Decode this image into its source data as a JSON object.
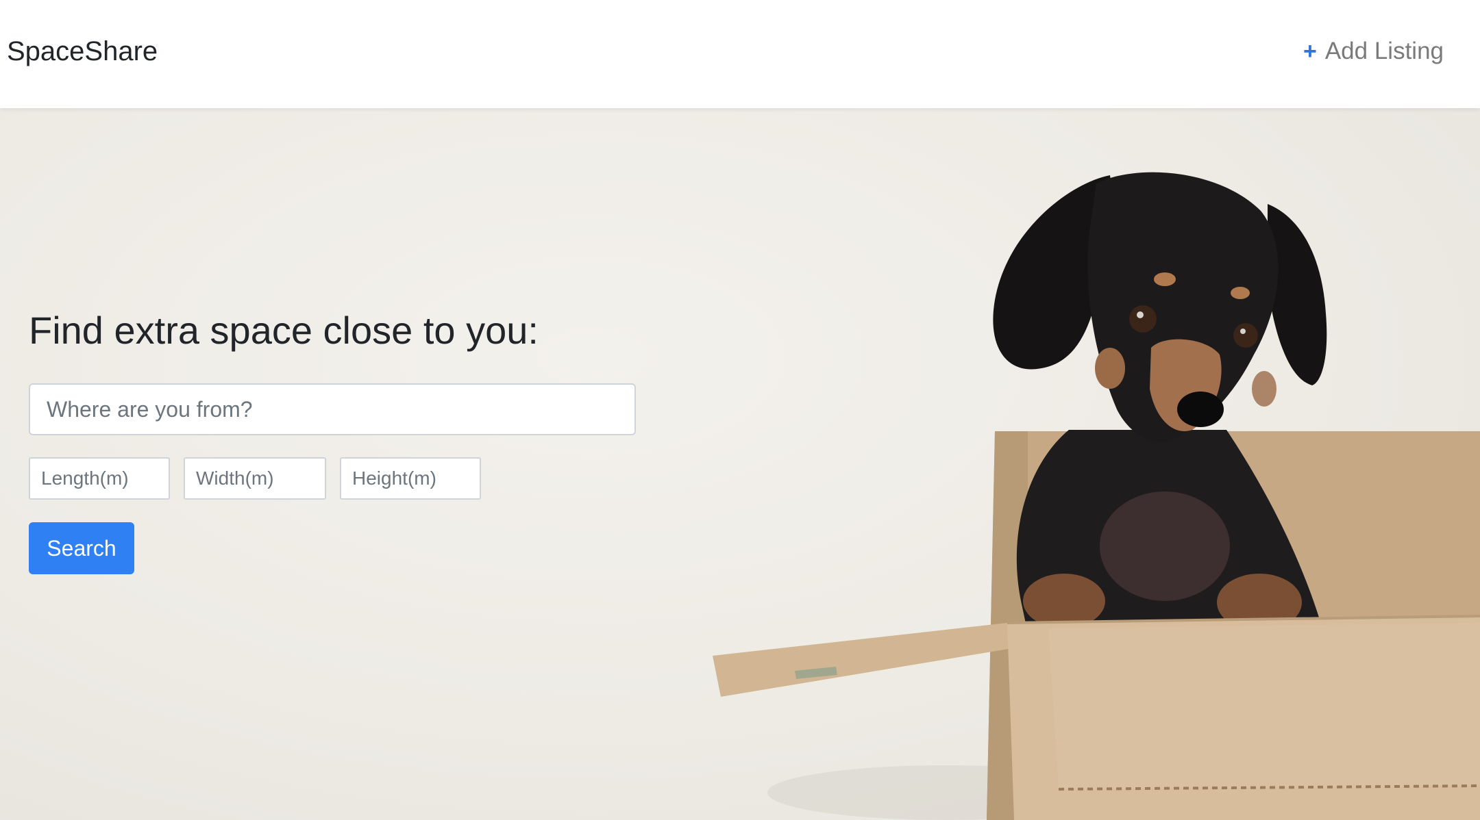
{
  "header": {
    "brand": "SpaceShare",
    "add_listing_icon": "+",
    "add_listing_label": "Add Listing"
  },
  "hero": {
    "headline": "Find extra space close to you:",
    "location_placeholder": "Where are you from?",
    "length_placeholder": "Length(m)",
    "width_placeholder": "Width(m)",
    "height_placeholder": "Height(m)",
    "search_label": "Search",
    "photo_subject": "dachshund-in-cardboard-box-photo"
  },
  "colors": {
    "accent": "#2f80f3",
    "link_icon": "#2f74d6",
    "text": "#212529",
    "hero_bg": "#eeebe5"
  }
}
